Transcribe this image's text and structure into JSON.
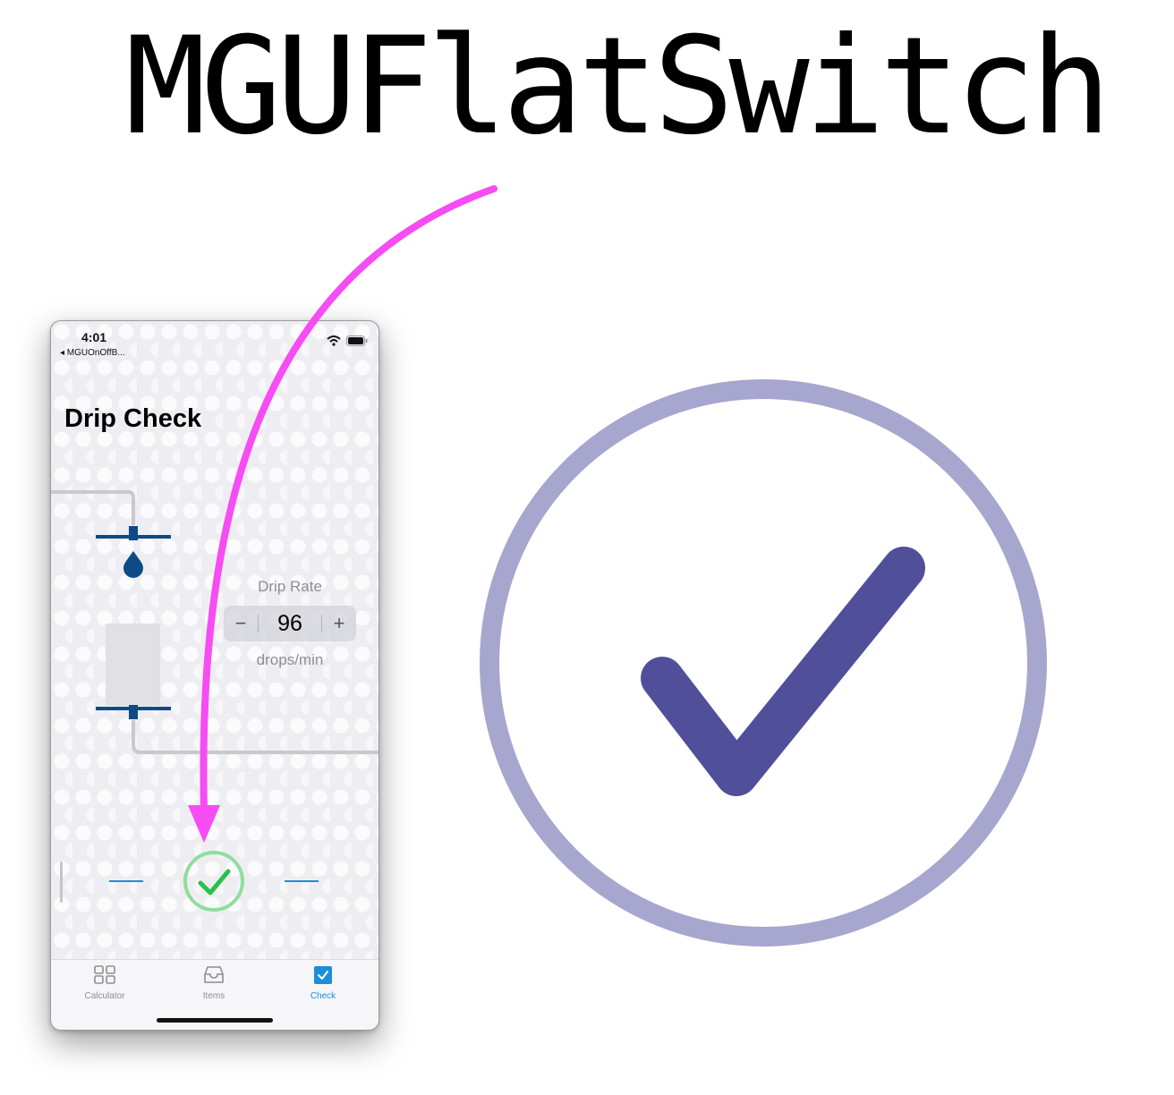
{
  "banner": {
    "title": "MGUFlatSwitch"
  },
  "phone": {
    "status": {
      "time": "4:01",
      "back_app": "◂ MGUOnOffB..."
    },
    "nav_title": "Drip Check",
    "drip": {
      "label": "Drip Rate",
      "value": "96",
      "minus": "−",
      "plus": "+",
      "units": "drops/min"
    },
    "tabs": [
      {
        "label": "Calculator",
        "icon": "grid-icon",
        "active": false
      },
      {
        "label": "Items",
        "icon": "tray-icon",
        "active": false
      },
      {
        "label": "Check",
        "icon": "checkbox-icon",
        "active": true
      }
    ],
    "switch_state": "on"
  },
  "colors": {
    "arrow": "#f64cf3",
    "big_check_ring": "#a7a6ce",
    "big_check_mark": "#514f9a",
    "small_check_ring": "#8ede9e",
    "small_check_mark": "#2bbf4e",
    "iv_blue": "#0c4b86",
    "tab_active": "#1c8fd8"
  }
}
